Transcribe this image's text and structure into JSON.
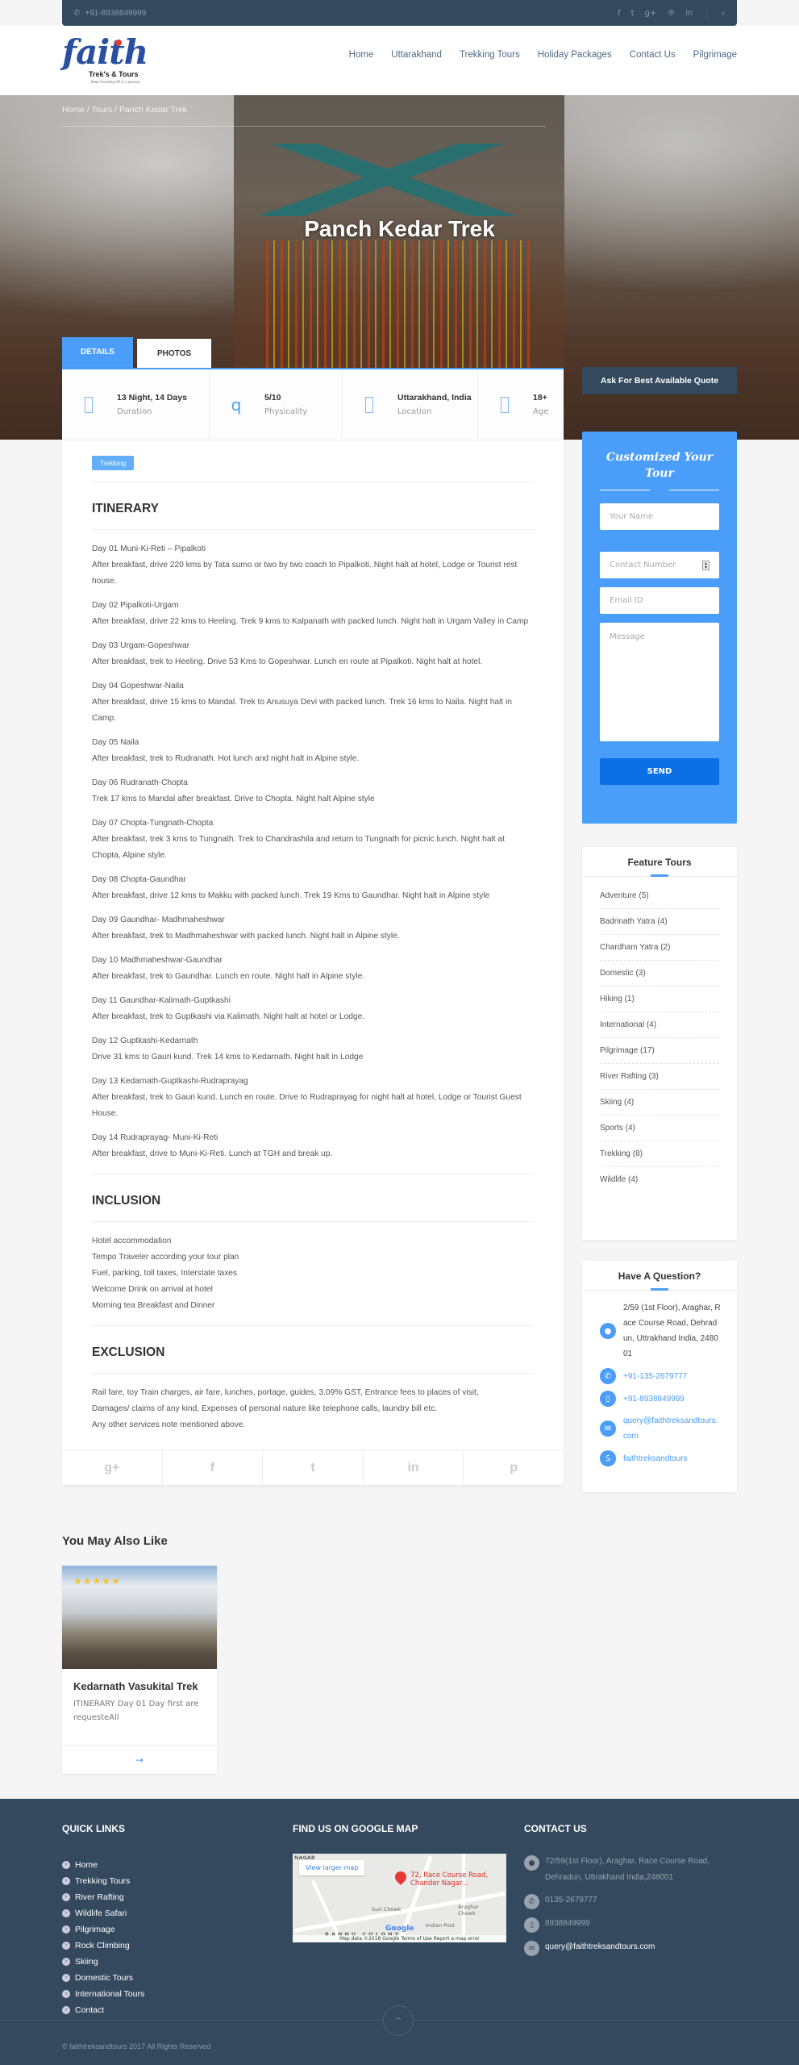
{
  "topbar": {
    "phone": "+91-8938849999",
    "phone_icon": "phone-icon",
    "social_icons": [
      "f",
      "t",
      "g+",
      "p",
      "in"
    ],
    "search_icon": "search-icon"
  },
  "logo": {
    "brand": "faith",
    "subtitle": "Trek's & Tours",
    "tagline": "Keep traveling life is a journey"
  },
  "nav": [
    "Home",
    "Uttarakhand",
    "Trekking Tours",
    "Holiday Packages",
    "Contact Us",
    "Pilgrimage"
  ],
  "hero": {
    "breadcrumb": "Home / Tours / Panch Kedar Trek",
    "title": "Panch Kedar Trek"
  },
  "tabs": {
    "details": "DETAILS",
    "photos": "PHOTOS"
  },
  "facts": [
    {
      "value": "13 Night, 14 Days",
      "label": "Duration"
    },
    {
      "value": "5/10",
      "label": "Physicality"
    },
    {
      "value": "Uttarakhand, India",
      "label": "Location"
    },
    {
      "value": "18+",
      "label": "Age"
    }
  ],
  "badge": "Trekking",
  "itinerary": {
    "heading": "ITINERARY",
    "days": [
      {
        "title": "Day 01 Muni-Ki-Reti – Pipalkoti",
        "text": "After breakfast, drive 220 kms by Tata sumo or two by two coach to Pipalkoti. Night halt at hotel, Lodge or Tourist rest house."
      },
      {
        "title": "Day 02 Pipalkoti-Urgam",
        "text": "After breakfast, drive 22 kms to Heeling. Trek 9 kms to Kalpanath with packed lunch. Night halt in Urgam Valley in Camp"
      },
      {
        "title": "Day 03 Urgam-Gopeshwar",
        "text": "After breakfast, trek to Heeling. Drive 53 Kms to Gopeshwar. Lunch en route at Pipalkoti. Night halt at hotel."
      },
      {
        "title": "Day 04 Gopeshwar-Naila",
        "text": "After breakfast, drive 15 kms to Mandal. Trek to Anusuya Devi with packed lunch. Trek 16 kms to Naila. Night halt in Camp."
      },
      {
        "title": "Day 05 Naila",
        "text": "After breakfast, trek to Rudranath. Hot lunch and night halt in Alpine style."
      },
      {
        "title": "Day 06 Rudranath-Chopta",
        "text": "Trek 17 kms to Mandal after breakfast. Drive to Chopta. Night halt Alpine style"
      },
      {
        "title": "Day 07 Chopta-Tungnath-Chopta",
        "text": "After breakfast, trek 3 kms to Tungnath. Trek to Chandrashila and return to Tungnath for picnic lunch. Night halt at Chopta, Alpine style."
      },
      {
        "title": "Day 08 Chopta-Gaundhar",
        "text": "After breakfast, drive 12 kms to Makku with packed lunch. Trek 19 Kms to Gaundhar. Night halt in Alpine style"
      },
      {
        "title": "Day 09 Gaundhar- Madhmaheshwar",
        "text": "After breakfast, trek to Madhmaheshwar with packed lunch. Night halt in Alpine style."
      },
      {
        "title": "Day 10 Madhmaheshwar-Gaundhar",
        "text": "After breakfast, trek to Gaundhar. Lunch en route. Night halt in Alpine style."
      },
      {
        "title": "Day 11 Gaundhar-Kalimath-Guptkashi",
        "text": "After breakfast, trek to Guptkashi via Kalimath. Night halt at hotel or Lodge."
      },
      {
        "title": "Day 12 Guptkashi-Kedarnath",
        "text": "Drive 31 kms to Gauri kund. Trek 14 kms to Kedarnath. Night halt in Lodge"
      },
      {
        "title": "Day 13 Kedarnath-Guptkashi-Rudraprayag",
        "text": "After breakfast, trek to Gauri kund. Lunch en route. Drive to Rudraprayag for night halt at hotel, Lodge or Tourist Guest House."
      },
      {
        "title": "Day 14 Rudraprayag- Muni-Ki-Reti",
        "text": "After breakfast, drive to Muni-Ki-Reti. Lunch at TGH and break up."
      }
    ]
  },
  "inclusion": {
    "heading": "INCLUSION",
    "items": [
      "Hotel accommodation",
      "Tempo Traveler according your tour plan",
      "Fuel, parking, toll taxes, Interstate taxes",
      "Welcome Drink on arrival at hotel",
      "Morning tea Breakfast and Dinner"
    ]
  },
  "exclusion": {
    "heading": "EXCLUSION",
    "lines": [
      "Rail fare, toy Train charges, air fare, lunches, portage, guides, 3.09% GST, Entrance fees to places of visit,",
      "Damages/ claims of any kind, Expenses of personal nature like telephone calls, laundry bill etc.",
      "Any other services note mentioned above."
    ]
  },
  "share": [
    "g+",
    "f",
    "t",
    "in",
    "p"
  ],
  "quote_button": "Ask For Best Available Quote",
  "form": {
    "title": "Customized Your Tour",
    "name_placeholder": "Your Name",
    "contact_placeholder": "Contact Number",
    "email_placeholder": "Email ID",
    "message_placeholder": "Message",
    "send": "SEND"
  },
  "feature_tours": {
    "title": "Feature Tours",
    "items": [
      "Adventure (5)",
      "Badrinath Yatra (4)",
      "Chardham Yatra (2)",
      "Domestic (3)",
      "Hiking (1)",
      "International (4)",
      "Pilgrimage (17)",
      "River Rafting (3)",
      "Skiing (4)",
      "Sports (4)",
      "Trekking (8)",
      "Wildlife (4)"
    ]
  },
  "question": {
    "title": "Have A Question?",
    "address": "2/59 (1st Floor), Araghar, Race Course Road, Dehradun, Uttrakhand India, 248001",
    "phone": "+91-135-2679777",
    "mobile": "+91-8938849999",
    "email": "query@faithtreksandtours.com",
    "skype": "faithtreksandtours"
  },
  "also_like": {
    "heading": "You May Also Like",
    "card": {
      "title": "Kedarnath Vasukital Trek",
      "desc": "ITINERARY Day 01 Day first are requesteAll",
      "rating": 5,
      "arrow": "→"
    }
  },
  "footer": {
    "quick_links_title": "QUICK LINKS",
    "quick_links": [
      "Home",
      "Trekking Tours",
      "River Rafting",
      "Wildlife Safari",
      "Pilgrimage",
      "Rock Climbing",
      "Skiing",
      "Domestic Tours",
      "International Tours",
      "Contact"
    ],
    "map_title": "FIND US ON GOOGLE MAP",
    "map": {
      "view_larger": "View larger map",
      "place": "72, Race Course Road, Chander Nagar...",
      "labels": [
        "Suri Chowk",
        "Araghar Chowk",
        "Indian Post",
        "NAGAR",
        "BANNU COLONY"
      ],
      "footer": "Map data ©2018 Google   Terms of Use   Report a map error",
      "google": "Google"
    },
    "contact_title": "CONTACT US",
    "address": "72/59(1st Floor), Araghar, Race Course Road, Dehradun, Uttrakhand India,248001",
    "phone": "0135-2679777",
    "mobile": "8938849999",
    "email": "query@faithtreksandtours.com",
    "copyright": "© faithtreksandtours 2017 All Rights Reserved",
    "to_top": "^"
  }
}
